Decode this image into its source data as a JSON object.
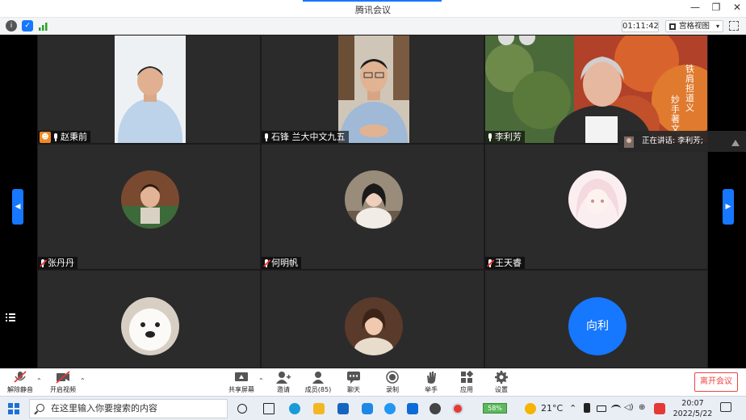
{
  "window": {
    "title": "腾讯会议",
    "controls": [
      "—",
      "❐",
      "✕"
    ]
  },
  "infobar": {
    "timer": "01:11:42",
    "view_label": "宫格视图"
  },
  "tiles": [
    {
      "name": "赵秉前",
      "mic": "on",
      "host": true
    },
    {
      "name": "石锋 兰大中文九五",
      "mic": "on"
    },
    {
      "name": "李利芳",
      "mic": "on"
    },
    {
      "name": "张丹丹",
      "mic": "off"
    },
    {
      "name": "何明帆",
      "mic": "off"
    },
    {
      "name": "王天睿",
      "mic": "off"
    },
    {
      "name": "",
      "mic": "off"
    },
    {
      "name": "",
      "mic": "off"
    },
    {
      "name": "",
      "mic": "off",
      "avatar_text": "向利"
    }
  ],
  "video_overlay": {
    "line1": "铁肩担道义",
    "line2": "妙手著文"
  },
  "speaking": {
    "label": "正在讲话: 李利芳;"
  },
  "toolbar": {
    "unmute": "解除静音",
    "start_video": "开启视频",
    "share": "共享屏幕",
    "invite": "邀请",
    "members": "成员(85)",
    "chat": "聊天",
    "record": "录制",
    "raise": "举手",
    "apps": "应用",
    "settings": "设置",
    "leave": "离开会议"
  },
  "taskbar": {
    "search_placeholder": "在这里输入你要搜索的内容",
    "battery": "58%",
    "weather": "21°C",
    "time": "20:07",
    "date": "2022/5/22"
  },
  "colors": {
    "accent": "#1677ff",
    "leave": "#ee4444",
    "host_badge": "#f08a24"
  }
}
